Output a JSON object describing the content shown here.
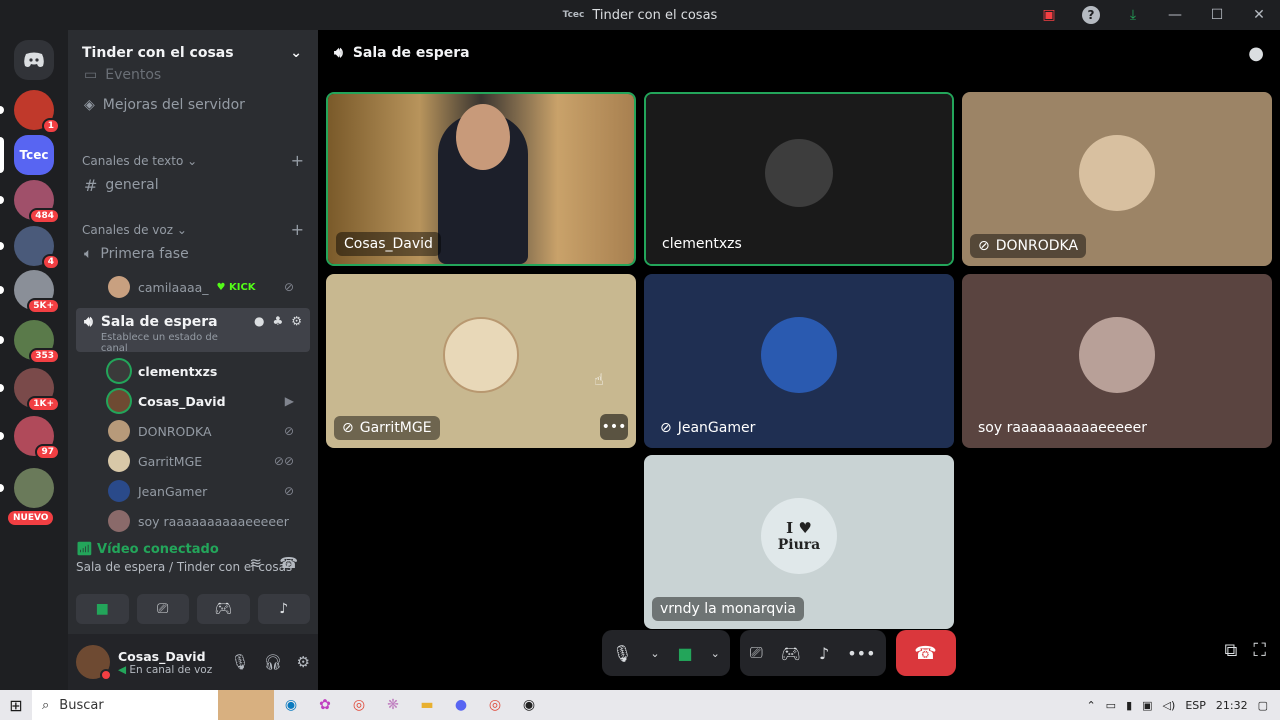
{
  "window": {
    "title": "Tinder con el cosas",
    "server_abbr": "Tcec"
  },
  "rail": {
    "servers": [
      {
        "name": "server-1",
        "badge": "1",
        "color": "#c0392b"
      },
      {
        "name": "server-tcec",
        "label": "Tcec",
        "color": "#5865f2"
      },
      {
        "name": "server-3",
        "badge": "484",
        "color": "#a0506a"
      },
      {
        "name": "server-4",
        "badge": "4",
        "color": "#4a5a7a"
      },
      {
        "name": "server-5",
        "badge": "5K+",
        "color": "#8a8f98"
      },
      {
        "name": "server-6",
        "badge": "353",
        "color": "#5a7a4a"
      },
      {
        "name": "server-7",
        "badge": "1K+",
        "color": "#7a4a4a"
      },
      {
        "name": "server-8",
        "badge": "97",
        "color": "#b04a5a"
      },
      {
        "name": "server-9",
        "color": "#6a7a5a"
      }
    ],
    "new_label": "NUEVO"
  },
  "sidebar": {
    "server_name": "Tinder con el cosas",
    "top_items": [
      {
        "label": "Eventos"
      },
      {
        "label": "Mejoras del servidor"
      }
    ],
    "text_category": "Canales de texto",
    "text_channels": [
      {
        "label": "general"
      }
    ],
    "voice_category": "Canales de voz",
    "voice_channels": [
      {
        "label": "Primera fase"
      },
      {
        "label": "Sala de espera",
        "status": "Establece un estado de canal"
      }
    ],
    "primera_users": [
      {
        "name": "camilaaaa_",
        "tag": "KICK"
      }
    ],
    "sala_users": [
      {
        "name": "clementxzs",
        "color": "#3a3a3a"
      },
      {
        "name": "Cosas_David",
        "color": "#6e4a32"
      },
      {
        "name": "DONRODKA",
        "color": "#b79a7a"
      },
      {
        "name": "GarritMGE",
        "color": "#d8c8a8"
      },
      {
        "name": "JeanGamer",
        "color": "#2a4a8a"
      },
      {
        "name": "soy raaaaaaaaaaeeeeer",
        "color": "#8a6a6a"
      }
    ]
  },
  "voice_connection": {
    "status": "Vídeo conectado",
    "location": "Sala de espera / Tinder con el cosas"
  },
  "user": {
    "name": "Cosas_David",
    "status": "En canal de voz"
  },
  "main": {
    "channel_title": "Sala de espera",
    "tiles": [
      {
        "name": "Cosas_David",
        "bg": "#6d5a3a",
        "speaking": true,
        "video": true
      },
      {
        "name": "clementxzs",
        "bg": "#1a1a1a",
        "speaking": true,
        "avatar": "#4a4a4a"
      },
      {
        "name": "DONRODKA",
        "bg": "#9c8466",
        "muted": true,
        "avatar": "#d8c0a0"
      },
      {
        "name": "GarritMGE",
        "bg": "#c8b890",
        "muted": true,
        "avatar": "#e8d8b8"
      },
      {
        "name": "JeanGamer",
        "bg": "#1f2f52",
        "muted": true,
        "avatar": "#2a5ab0"
      },
      {
        "name": "soy raaaaaaaaaaeeeeer",
        "bg": "#5a4440",
        "avatar": "#b8a098"
      },
      {
        "name": "vrndy la monarqvia",
        "bg": "#c9d3d4",
        "avatar": "#e0e8ea"
      }
    ],
    "piura_line1": "I ♥",
    "piura_line2": "Piura"
  },
  "taskbar": {
    "search_placeholder": "Buscar",
    "language": "ESP",
    "time": "21:32"
  }
}
